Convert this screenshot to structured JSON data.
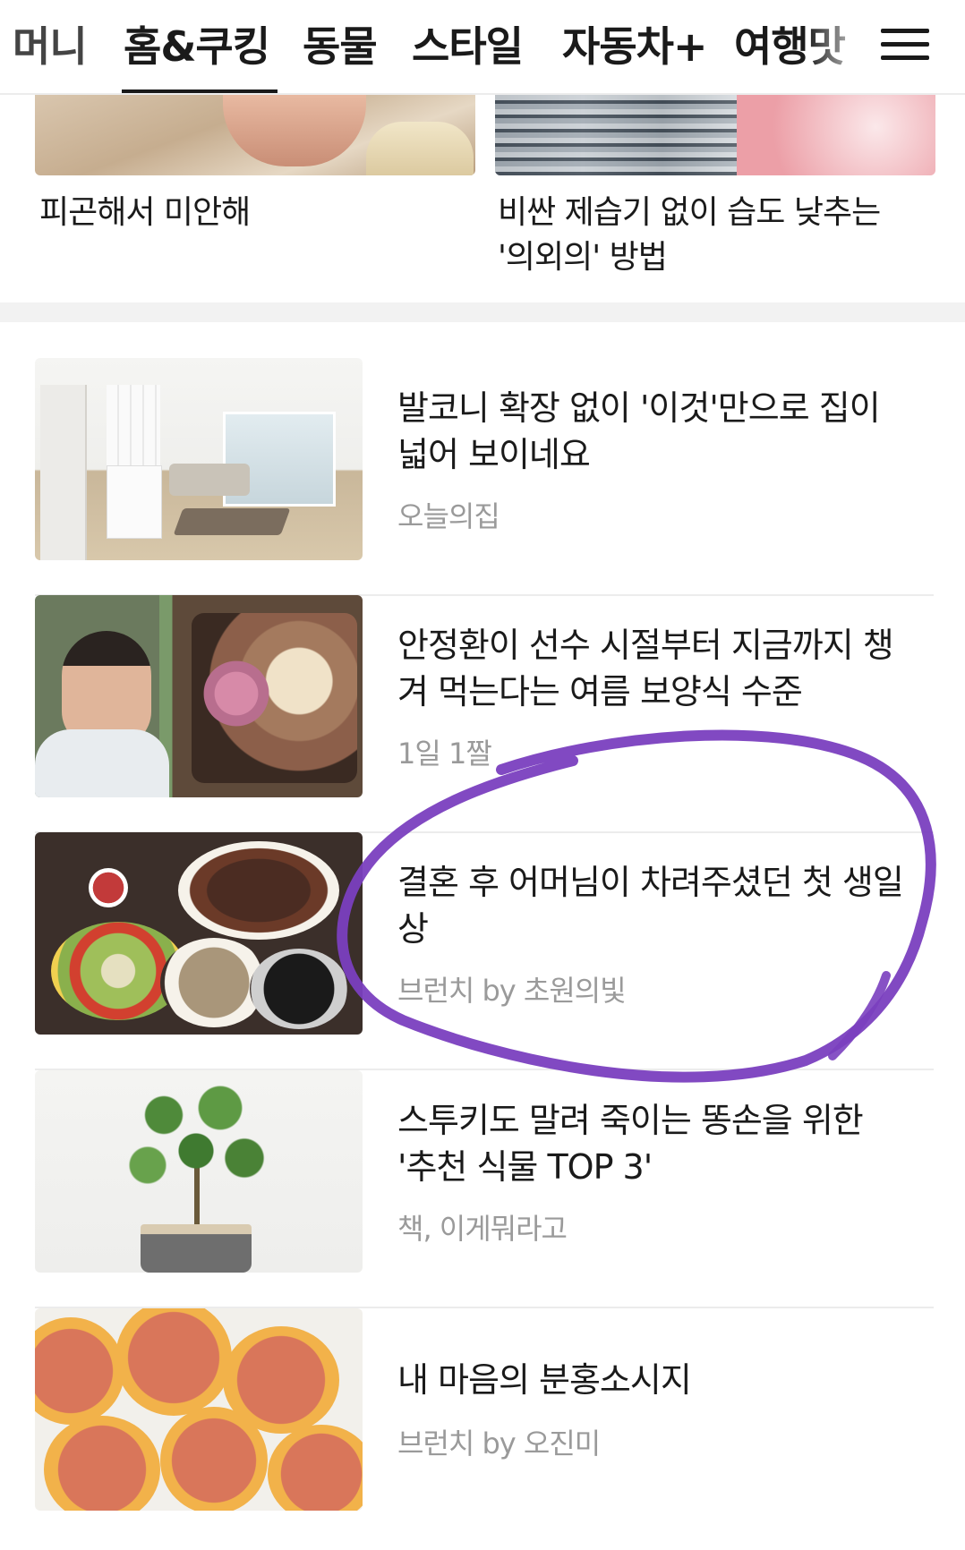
{
  "tabs": [
    {
      "label": "머니"
    },
    {
      "label": "홈&쿠킹",
      "active": true
    },
    {
      "label": "동물"
    },
    {
      "label": "스타일"
    },
    {
      "label": "자동차+"
    },
    {
      "label": "여행맛"
    }
  ],
  "top_cards": [
    {
      "title": "피곤해서 미안해"
    },
    {
      "title": "비싼 제습기 없이 습도 낮추는 '의외의' 방법"
    }
  ],
  "articles": [
    {
      "title": "발코니 확장 없이 '이것'만으로 집이 넓어 보이네요",
      "source": "오늘의집"
    },
    {
      "title": "안정환이 선수 시절부터 지금까지 챙겨 먹는다는 여름 보양식 수준",
      "source": "1일 1짤"
    },
    {
      "title": "결혼 후 어머님이 차려주셨던 첫 생일상",
      "source": "브런치 by 초원의빛",
      "highlighted": true
    },
    {
      "title": "스투키도 말려 죽이는 똥손을 위한 '추천 식물 TOP 3'",
      "source": "책, 이게뭐라고"
    },
    {
      "title": "내 마음의 분홍소시지",
      "source": "브런치 by 오진미"
    }
  ],
  "colors": {
    "annotation": "#7a3fbf",
    "source_text": "#9a9a9a",
    "active_tab_underline": "#1a1a1a"
  },
  "icons": {
    "menu": "hamburger-menu-icon"
  }
}
